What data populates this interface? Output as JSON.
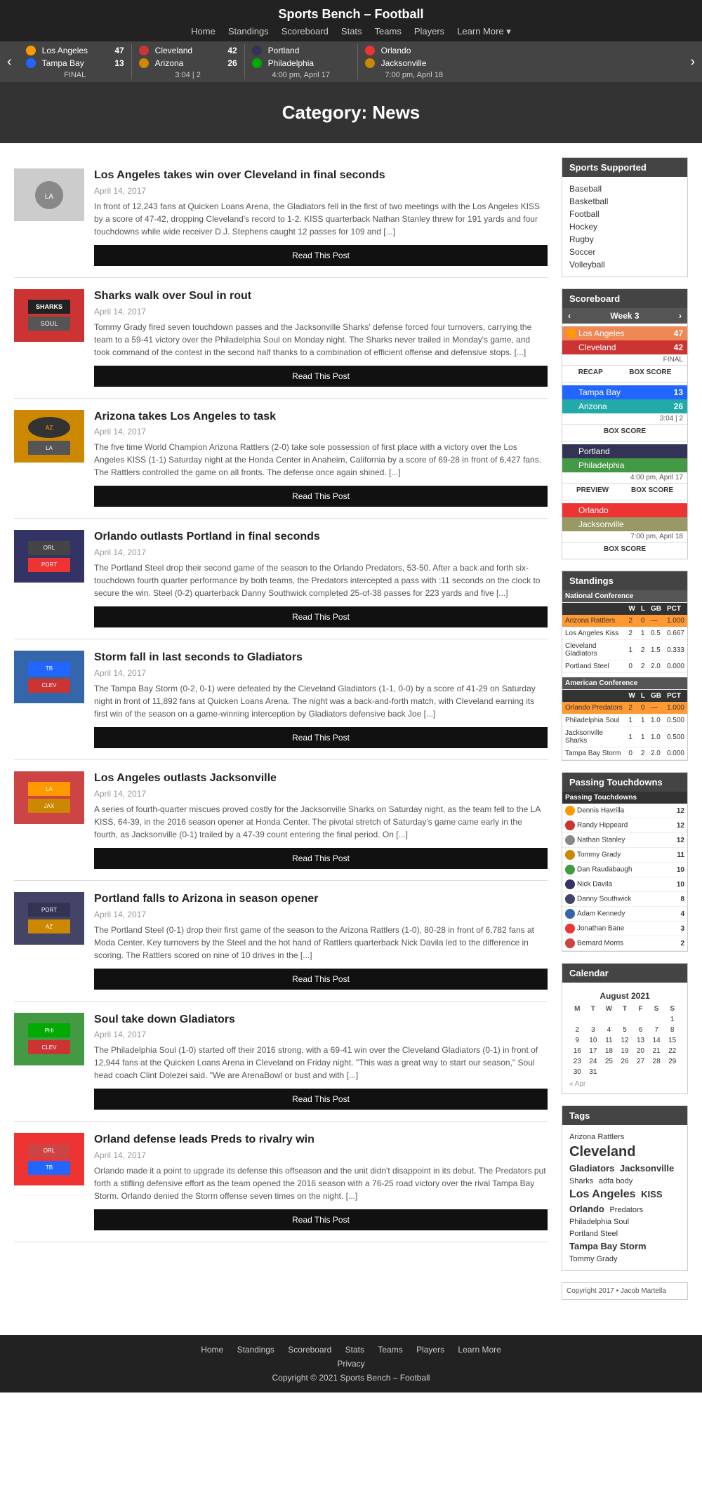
{
  "site": {
    "title": "Sports Bench – Football",
    "nav": [
      "Home",
      "Standings",
      "Scoreboard",
      "Stats",
      "Teams",
      "Players",
      "Learn More ▾"
    ],
    "copyright_header": "Copyright 2017 • Jacob Martella",
    "copyright_footer": "Copyright © 2021 Sports Bench – Football",
    "footer_nav": [
      "Home",
      "Standings",
      "Scoreboard",
      "Stats",
      "Teams",
      "Players",
      "Learn More",
      "Privacy"
    ]
  },
  "ticker": {
    "games": [
      {
        "team1": "Los Angeles",
        "score1": "47",
        "team2": "Tampa Bay",
        "score2": "13",
        "status": "FINAL",
        "color1": "orange",
        "color2": "blue"
      },
      {
        "team1": "Cleveland",
        "score1": "42",
        "team2": "Arizona",
        "score2": "26",
        "status": "3:04 | 2",
        "color1": "red",
        "color2": "red2"
      },
      {
        "team1": "Portland",
        "score1": "",
        "team2": "Philadelphia",
        "score2": "",
        "status": "4:00 pm, April 17",
        "color1": "darkblue",
        "color2": "green"
      },
      {
        "team1": "Orlando",
        "score1": "",
        "team2": "Jacksonville",
        "score2": "",
        "status": "7:00 pm, April 18",
        "color1": "brightred",
        "color2": "gold"
      }
    ]
  },
  "category": {
    "title": "Category: News"
  },
  "articles": [
    {
      "title": "Los Angeles takes win over Cleveland in final seconds",
      "date": "April 14, 2017",
      "excerpt": "In front of 12,243 fans at Quicken Loans Arena, the Gladiators fell in the first of two meetings with the Los Angeles KISS by a score of 47-42, dropping Cleveland's record to 1-2. KISS quarterback Nathan Stanley threw for 191 yards and four touchdowns while wide receiver D.J. Stephens caught 12 passes for 109 and [...]",
      "btn": "Read This Post",
      "thumb_color": "#888"
    },
    {
      "title": "Sharks walk over Soul in rout",
      "date": "April 14, 2017",
      "excerpt": "Tommy Grady fired seven touchdown passes and the Jacksonville Sharks' defense forced four turnovers, carrying the team to a 59-41 victory over the Philadelphia Soul on Monday night. The Sharks never trailed in Monday's game, and took command of the contest in the second half thanks to a combination of efficient offense and defensive stops. [...]",
      "btn": "Read This Post",
      "thumb_color": "#c33"
    },
    {
      "title": "Arizona takes Los Angeles to task",
      "date": "April 14, 2017",
      "excerpt": "The five time World Champion Arizona Rattlers (2-0) take sole possession of first place with a victory over the Los Angeles KISS (1-1) Saturday night at the Honda Center in Anaheim, California by a score of 69-28 in front of 6,427 fans. The Rattlers controlled the game on all fronts. The defense once again shined. [...]",
      "btn": "Read This Post",
      "thumb_color": "#c80"
    },
    {
      "title": "Orlando outlasts Portland in final seconds",
      "date": "April 14, 2017",
      "excerpt": "The Portland Steel drop their second game of the season to the Orlando Predators, 53-50. After a back and forth six-touchdown fourth quarter performance by both teams, the Predators intercepted a pass with :11 seconds on the clock to secure the win. Steel (0-2) quarterback Danny Southwick completed 25-of-38 passes for 223 yards and five [...]",
      "btn": "Read This Post",
      "thumb_color": "#336"
    },
    {
      "title": "Storm fall in last seconds to Gladiators",
      "date": "April 14, 2017",
      "excerpt": "The Tampa Bay Storm (0-2, 0-1) were defeated by the Cleveland Gladiators (1-1, 0-0) by a score of 41-29 on Saturday night in front of 11,892 fans at Quicken Loans Arena. The night was a back-and-forth match, with Cleveland earning its first win of the season on a game-winning interception by Gladiators defensive back Joe [...]",
      "btn": "Read This Post",
      "thumb_color": "#36a"
    },
    {
      "title": "Los Angeles outlasts Jacksonville",
      "date": "April 14, 2017",
      "excerpt": "A series of fourth-quarter miscues proved costly for the Jacksonville Sharks on Saturday night, as the team fell to the LA KISS, 64-39, in the 2016 season opener at Honda Center. The pivotal stretch of Saturday's game came early in the fourth, as Jacksonville (0-1) trailed by a 47-39 count entering the final period. On [...]",
      "btn": "Read This Post",
      "thumb_color": "#c44"
    },
    {
      "title": "Portland falls to Arizona in season opener",
      "date": "April 14, 2017",
      "excerpt": "The Portland Steel (0-1) drop their first game of the season to the Arizona Rattlers (1-0), 80-28 in front of 6,782 fans at Moda Center. Key turnovers by the Steel and the hot hand of Rattlers quarterback Nick Davila led to the difference in scoring. The Rattlers scored on nine of 10 drives in the [...]",
      "btn": "Read This Post",
      "thumb_color": "#446"
    },
    {
      "title": "Soul take down Gladiators",
      "date": "April 14, 2017",
      "excerpt": "The Philadelphia Soul (1-0) started off their 2016 strong, with a 69-41 win over the Cleveland Gladiators (0-1) in front of 12,944 fans at the Quicken Loans Arena in Cleveland on Friday night. \"This was a great way to start our season,\" Soul head coach Clint Dolezei said. \"We are ArenaBowl or bust and with [...]",
      "btn": "Read This Post",
      "thumb_color": "#494"
    },
    {
      "title": "Orland defense leads Preds to rivalry win",
      "date": "April 14, 2017",
      "excerpt": "Orlando made it a point to upgrade its defense this offseason and the unit didn't disappoint in its debut. The Predators put forth a stifling defensive effort as the team opened the 2016 season with a 76-25 road victory over the rival Tampa Bay Storm. Orlando denied the Storm offense seven times on the night. [...]",
      "btn": "Read This Post",
      "thumb_color": "#e33"
    }
  ],
  "sidebar": {
    "sports_supported": {
      "title": "Sports Supported",
      "sports": [
        "Baseball",
        "Basketball",
        "Football",
        "Hockey",
        "Rugby",
        "Soccer",
        "Volleyball"
      ]
    },
    "scoreboard": {
      "title": "Scoreboard",
      "week": "Week 3",
      "games": [
        {
          "team1": "Los Angeles",
          "pts1": 47,
          "color1": "orange",
          "team2": "Cleveland",
          "pts2": 42,
          "color2": "red",
          "status": "FINAL",
          "actions": [
            "RECAP",
            "BOX SCORE"
          ]
        },
        {
          "team1": "Tampa Bay",
          "pts1": 13,
          "color1": "blue",
          "team2": "Arizona",
          "pts2": 26,
          "color2": "teal",
          "status": "3:04 | 2",
          "actions": [
            "BOX SCORE"
          ]
        },
        {
          "team1": "Portland",
          "pts1": null,
          "color1": "dark-blue",
          "team2": "Philadelphia",
          "pts2": null,
          "color2": "green",
          "status": "4:00 pm, April 17",
          "actions": [
            "PREVIEW",
            "BOX SCORE"
          ]
        },
        {
          "team1": "Orlando",
          "pts1": null,
          "color1": "bright-red",
          "team2": "Jacksonville",
          "pts2": null,
          "color2": "gold",
          "status": "7:00 pm, April 18",
          "actions": [
            "BOX SCORE"
          ]
        }
      ]
    },
    "standings": {
      "title": "Standings",
      "conferences": [
        {
          "name": "National Conference",
          "headers": [
            "W",
            "L",
            "GB",
            "PCT"
          ],
          "teams": [
            {
              "name": "Arizona Rattlers",
              "w": 2,
              "l": 0,
              "gb": "—",
              "pct": "1.000",
              "highlight": "orange"
            },
            {
              "name": "Los Angeles Kiss",
              "w": 2,
              "l": 1,
              "gb": "0.5",
              "pct": "0.667",
              "highlight": ""
            },
            {
              "name": "Cleveland Gladiators",
              "w": 1,
              "l": 2,
              "gb": "1.5",
              "pct": "0.333",
              "highlight": ""
            },
            {
              "name": "Portland Steel",
              "w": 0,
              "l": 2,
              "gb": "2.0",
              "pct": "0.000",
              "highlight": ""
            }
          ]
        },
        {
          "name": "American Conference",
          "headers": [
            "W",
            "L",
            "GB",
            "PCT"
          ],
          "teams": [
            {
              "name": "Orlando Predators",
              "w": 2,
              "l": 0,
              "gb": "—",
              "pct": "1.000",
              "highlight": "orange"
            },
            {
              "name": "Philadelphia Soul",
              "w": 1,
              "l": 1,
              "gb": "1.0",
              "pct": "0.500",
              "highlight": ""
            },
            {
              "name": "Jacksonville Sharks",
              "w": 1,
              "l": 1,
              "gb": "1.0",
              "pct": "0.500",
              "highlight": ""
            },
            {
              "name": "Tampa Bay Storm",
              "w": 0,
              "l": 2,
              "gb": "2.0",
              "pct": "0.000",
              "highlight": ""
            }
          ]
        }
      ]
    },
    "passing_tds": {
      "title": "Passing Touchdowns",
      "header": "Passing Touchdowns",
      "players": [
        {
          "name": "Dennis Havrilla",
          "tds": 12,
          "color": "#f90"
        },
        {
          "name": "Randy Hippeard",
          "tds": 12,
          "color": "#c33"
        },
        {
          "name": "Nathan Stanley",
          "tds": 12,
          "color": "#888"
        },
        {
          "name": "Tommy Grady",
          "tds": 11,
          "color": "#c80"
        },
        {
          "name": "Dan Raudabaugh",
          "tds": 10,
          "color": "#494"
        },
        {
          "name": "Nick Davila",
          "tds": 10,
          "color": "#336"
        },
        {
          "name": "Danny Southwick",
          "tds": 8,
          "color": "#446"
        },
        {
          "name": "Adam Kennedy",
          "tds": 4,
          "color": "#36a"
        },
        {
          "name": "Jonathan Bane",
          "tds": 3,
          "color": "#e33"
        },
        {
          "name": "Bernard Morris",
          "tds": 2,
          "color": "#c44"
        }
      ]
    },
    "calendar": {
      "title": "Calendar",
      "month": "August 2021",
      "days_header": [
        "M",
        "T",
        "W",
        "T",
        "F",
        "S",
        "S"
      ],
      "weeks": [
        [
          "",
          "",
          "",
          "",
          "",
          "",
          "1"
        ],
        [
          "2",
          "3",
          "4",
          "5",
          "6",
          "7",
          "8"
        ],
        [
          "9",
          "10",
          "11",
          "12",
          "13",
          "14",
          "15"
        ],
        [
          "16",
          "17",
          "18",
          "19",
          "20",
          "21",
          "22"
        ],
        [
          "23",
          "24",
          "25",
          "26",
          "27",
          "28",
          "29"
        ],
        [
          "30",
          "31",
          "",
          "",
          "",
          "",
          ""
        ]
      ],
      "prev": "« Apr"
    },
    "tags": {
      "title": "Tags",
      "tags": [
        {
          "label": "Arizona Rattlers",
          "size": "small"
        },
        {
          "label": "Cleveland",
          "size": "xl"
        },
        {
          "label": "Gladiators",
          "size": "medium"
        },
        {
          "label": "Jacksonville",
          "size": "medium"
        },
        {
          "label": "Sharks",
          "size": "small"
        },
        {
          "label": "adfa body",
          "size": "small"
        },
        {
          "label": "Los Angeles",
          "size": "large"
        },
        {
          "label": "KISS",
          "size": "medium"
        },
        {
          "label": "Orlando",
          "size": "medium"
        },
        {
          "label": "Predators",
          "size": "small"
        },
        {
          "label": "Philadelphia Soul",
          "size": "small"
        },
        {
          "label": "Portland Steel",
          "size": "small"
        },
        {
          "label": "Tampa Bay Storm",
          "size": "medium"
        },
        {
          "label": "Tommy Grady",
          "size": "small"
        }
      ]
    }
  }
}
